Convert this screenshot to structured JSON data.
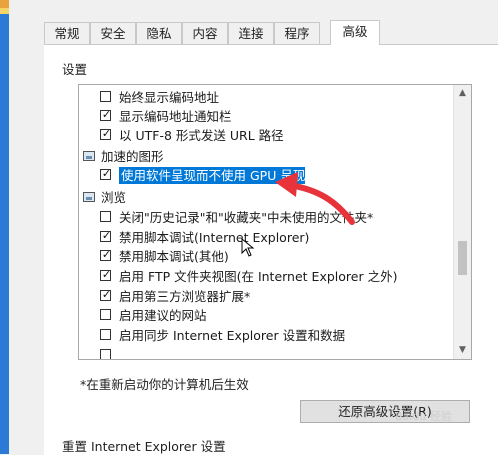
{
  "tabs": [
    {
      "label": "常规"
    },
    {
      "label": "安全"
    },
    {
      "label": "隐私"
    },
    {
      "label": "内容"
    },
    {
      "label": "连接"
    },
    {
      "label": "程序"
    },
    {
      "label": "高级",
      "active": true
    }
  ],
  "settings": {
    "section_label": "设置",
    "rows": [
      {
        "type": "checkbox",
        "checked": false,
        "label": "始终显示编码地址"
      },
      {
        "type": "checkbox",
        "checked": true,
        "label": "显示编码地址通知栏"
      },
      {
        "type": "checkbox",
        "checked": true,
        "label": "以 UTF-8 形式发送 URL 路径"
      },
      {
        "type": "category",
        "icon": "graphics-icon",
        "label": "加速的图形"
      },
      {
        "type": "checkbox",
        "checked": true,
        "selected": true,
        "label": "使用软件呈现而不使用 GPU 呈现*"
      },
      {
        "type": "category",
        "icon": "browse-icon",
        "label": "浏览"
      },
      {
        "type": "checkbox",
        "checked": false,
        "label": "关闭\"历史记录\"和\"收藏夹\"中未使用的文件夹*"
      },
      {
        "type": "checkbox",
        "checked": true,
        "label": "禁用脚本调试(Internet Explorer)"
      },
      {
        "type": "checkbox",
        "checked": true,
        "label": "禁用脚本调试(其他)"
      },
      {
        "type": "checkbox",
        "checked": true,
        "label": "启用 FTP 文件夹视图(在 Internet Explorer 之外)"
      },
      {
        "type": "checkbox",
        "checked": true,
        "label": "启用第三方浏览器扩展*"
      },
      {
        "type": "checkbox",
        "checked": false,
        "label": "启用建议的网站"
      },
      {
        "type": "checkbox",
        "checked": false,
        "label": "启用同步 Internet Explorer 设置和数据"
      }
    ],
    "scroll_position": 0.55
  },
  "note": "*在重新启动你的计算机后生效",
  "restore_button": "还原高级设置(R)",
  "reset_section_label": "重置 Internet Explorer 设置",
  "colors": {
    "selection": "#0078d7",
    "annotation_arrow": "#e8333a"
  }
}
